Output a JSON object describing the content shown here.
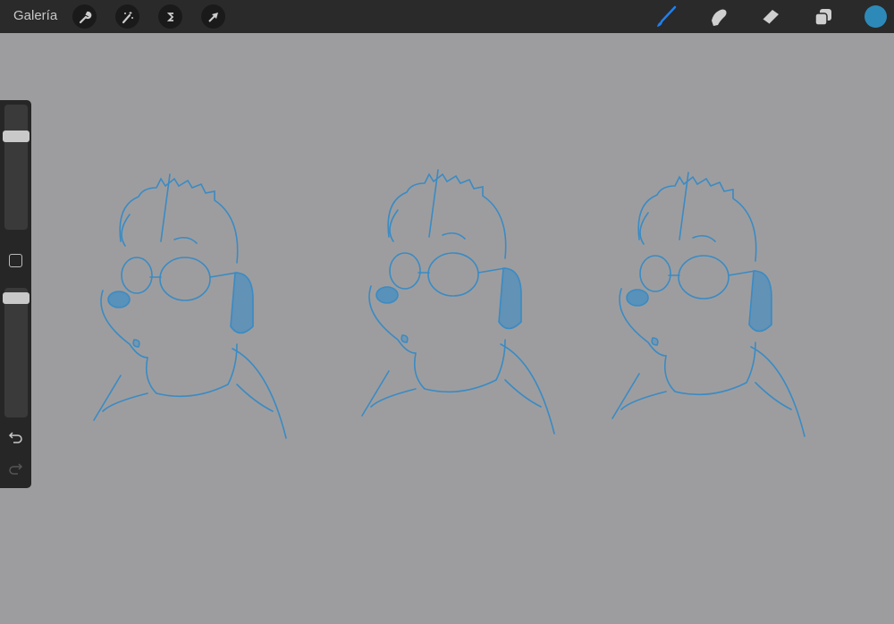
{
  "topbar": {
    "gallery_label": "Galería",
    "left_tools": [
      "wrench-icon",
      "magic-wand-icon",
      "selection-icon",
      "transform-arrow-icon"
    ],
    "right_tools": [
      "brush-icon",
      "smudge-icon",
      "eraser-icon",
      "layers-icon"
    ],
    "active_tool": "brush",
    "accent_color": "#1f7ff0",
    "current_color": "#2d8ab8"
  },
  "sidebar": {
    "brush_size": 0.72,
    "opacity": 0.9
  },
  "canvas": {
    "background": "#9d9d9f",
    "sketch_color": "#3a8bc4",
    "sketch_count": 3
  }
}
